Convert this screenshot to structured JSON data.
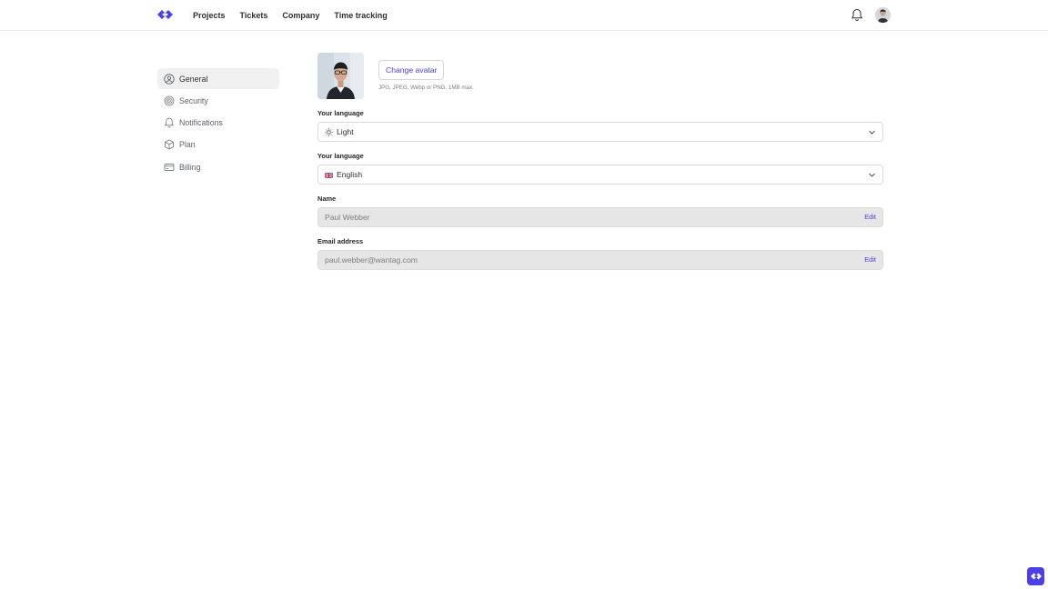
{
  "header": {
    "logo_icon": "brand-logo-icon",
    "nav": [
      {
        "label": "Projects"
      },
      {
        "label": "Tickets"
      },
      {
        "label": "Company"
      },
      {
        "label": "Time tracking"
      }
    ],
    "notification_icon": "bell-icon",
    "user_avatar_icon": "user-avatar"
  },
  "sidebar": {
    "items": [
      {
        "label": "General",
        "icon": "user-circle-icon",
        "active": true
      },
      {
        "label": "Security",
        "icon": "fingerprint-icon",
        "active": false
      },
      {
        "label": "Notifications",
        "icon": "bell-icon",
        "active": false
      },
      {
        "label": "Plan",
        "icon": "box-icon",
        "active": false
      },
      {
        "label": "Billing",
        "icon": "credit-card-icon",
        "active": false
      }
    ]
  },
  "profile": {
    "change_avatar_label": "Change avatar",
    "avatar_hint": "JPG, JPEG, Webp or PNG. 1MB max."
  },
  "fields": {
    "theme": {
      "label": "Your language",
      "value": "Light",
      "icon": "sun-icon"
    },
    "language": {
      "label": "Your language",
      "value": "English",
      "icon": "uk-flag-icon"
    },
    "name": {
      "label": "Name",
      "value": "Paul Webber",
      "action": "Edit"
    },
    "email": {
      "label": "Email address",
      "value": "paul.webber@wantag.com",
      "action": "Edit"
    }
  },
  "colors": {
    "accent": "#4a3fe4",
    "readonly_bg": "#e6e6e6",
    "active_side_bg": "#f0f0f0"
  },
  "fab_icon": "brand-logo-icon"
}
